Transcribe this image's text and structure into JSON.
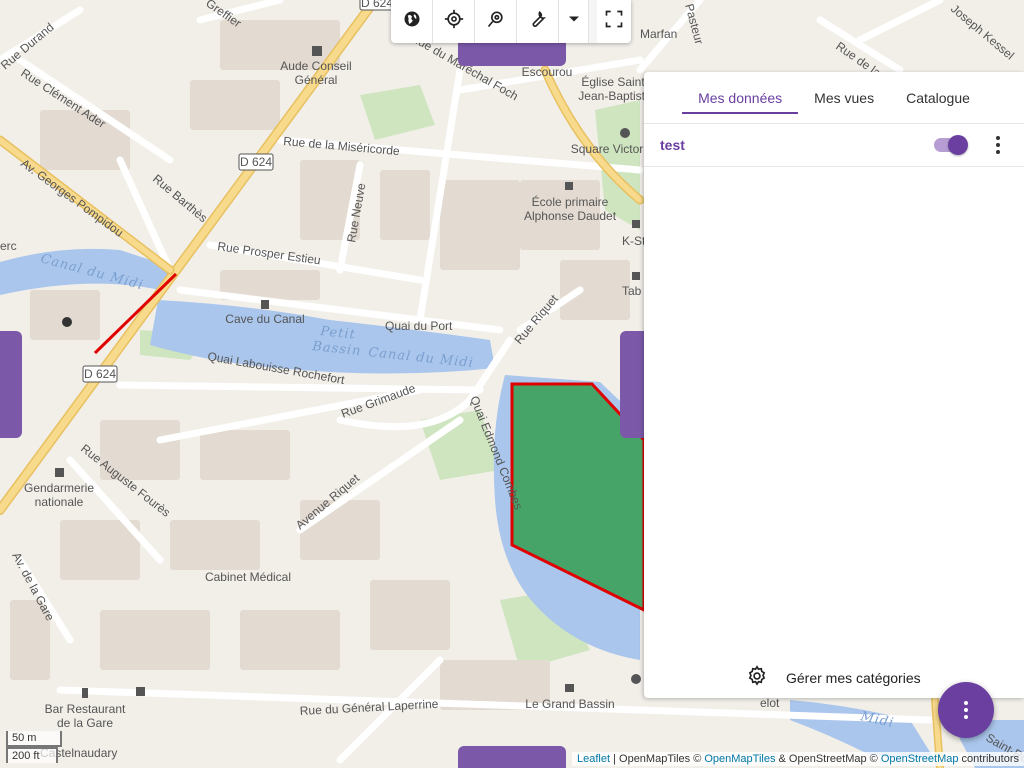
{
  "toolbar": {
    "buttons": [
      {
        "name": "globe-icon"
      },
      {
        "name": "crosshair-icon"
      },
      {
        "name": "search-location-icon"
      },
      {
        "name": "wrench-icon"
      },
      {
        "name": "chevron-down-icon"
      },
      {
        "name": "fullscreen-icon"
      }
    ]
  },
  "panel": {
    "tabs": [
      {
        "label": "Mes données",
        "active": true
      },
      {
        "label": "Mes vues",
        "active": false
      },
      {
        "label": "Catalogue",
        "active": false
      }
    ],
    "layers": [
      {
        "name": "test",
        "visible": true
      }
    ],
    "manage_label": "Gérer mes catégories"
  },
  "map": {
    "labels": {
      "aude_conseil": "Aude Conseil",
      "general": "Général",
      "rue_durand": "Rue Durand",
      "rue_clement_ader": "Rue Clément Ader",
      "rue_greffier": "Greffier",
      "rue_marechal_foch": "Rue du Maréchal Foch",
      "escourou": "Escourou",
      "eglise": "Église Saint-",
      "jean_baptiste": "Jean-Baptiste",
      "marfan": "Marfan",
      "pasteur": "Pasteur",
      "rue_de_la": "Rue de la",
      "joseph_kessel": "Joseph Kessel",
      "d624_top": "D 624",
      "d624_mid": "D 624",
      "d624_low": "D 624",
      "rue_misericorde": "Rue de la Miséricorde",
      "square_victor": "Square Victor",
      "av_georges_pompidou": "Av. Georges Pompidou",
      "rue_barthes": "Rue Barthès",
      "rue_neuve": "Rue Neuve",
      "ecole_primaire": "École primaire",
      "alphonse_daudet": "Alphonse Daudet",
      "k_st": "K-St",
      "rue_prosper_estieu": "Rue Prosper Estieu",
      "canal_du_midi_1": "Canal du Midi",
      "canal_du_midi_2": "Canal du Midi",
      "canal_du_midi_3": "Midi",
      "petit": "Petit",
      "bassin": "Bassin",
      "tab": "Tab",
      "erc": "erc",
      "cave_du_canal": "Cave du Canal",
      "quai_du_port": "Quai du Port",
      "rue_riquet": "Rue Riquet",
      "quai_labouisse": "Quai Labouisse Rochefort",
      "rue_grimaude": "Rue Grimaude",
      "quai_edmond_combes": "Quai Edmond Combes",
      "rue_auguste_foures": "Rue Auguste Fourès",
      "gendarmerie": "Gendarmerie",
      "nationale": "nationale",
      "avenue_riquet": "Avenue Riquet",
      "av_de_la_gare": "Av. de la Gare",
      "cabinet_medical": "Cabinet Médical",
      "bar_restaurant": "Bar Restaurant",
      "de_la_gare": "de la Gare",
      "castelnaudary": "Castelnaudary",
      "rue_general_laperrine": "Rue du Général Laperrine",
      "le_grand_bassin": "Le Grand Bassin",
      "elot": "elot",
      "saint_ro": "Saint-Ro"
    }
  },
  "scale": {
    "metric": "50 m",
    "imperial": "200 ft"
  },
  "attribution": {
    "leaflet": "Leaflet",
    "sep1": " | OpenMapTiles © ",
    "openmaptiles": "OpenMapTiles",
    "sep2": " & OpenStreetMap © ",
    "osm": "OpenStreetMap",
    "sep3": " contributors"
  },
  "colors": {
    "accent": "#6a3fa0",
    "polygon_fill": "#3ca05a",
    "polygon_stroke": "#e00000",
    "water": "#aac6ec"
  }
}
